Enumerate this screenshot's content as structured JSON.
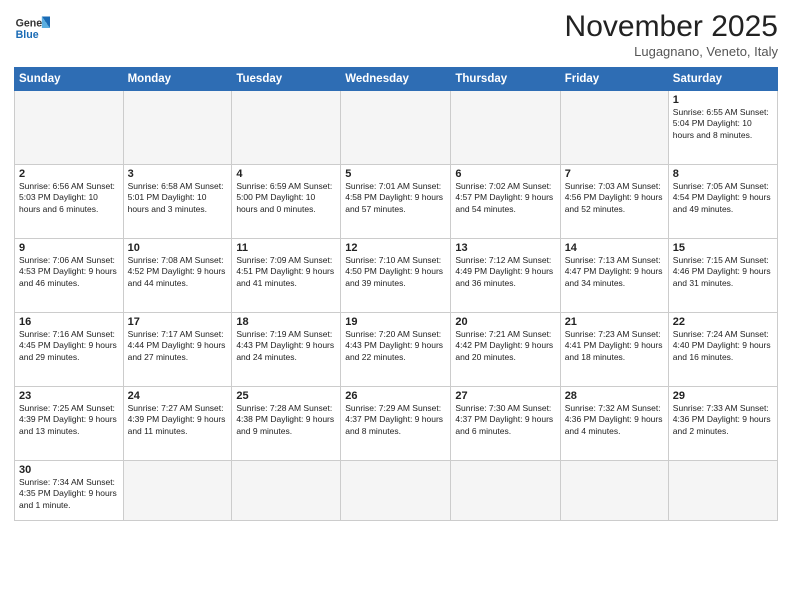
{
  "header": {
    "logo_general": "General",
    "logo_blue": "Blue",
    "month_title": "November 2025",
    "location": "Lugagnano, Veneto, Italy"
  },
  "days_of_week": [
    "Sunday",
    "Monday",
    "Tuesday",
    "Wednesday",
    "Thursday",
    "Friday",
    "Saturday"
  ],
  "weeks": [
    [
      {
        "num": "",
        "info": "",
        "empty": true
      },
      {
        "num": "",
        "info": "",
        "empty": true
      },
      {
        "num": "",
        "info": "",
        "empty": true
      },
      {
        "num": "",
        "info": "",
        "empty": true
      },
      {
        "num": "",
        "info": "",
        "empty": true
      },
      {
        "num": "",
        "info": "",
        "empty": true
      },
      {
        "num": "1",
        "info": "Sunrise: 6:55 AM\nSunset: 5:04 PM\nDaylight: 10 hours\nand 8 minutes.",
        "empty": false
      }
    ],
    [
      {
        "num": "2",
        "info": "Sunrise: 6:56 AM\nSunset: 5:03 PM\nDaylight: 10 hours\nand 6 minutes.",
        "empty": false
      },
      {
        "num": "3",
        "info": "Sunrise: 6:58 AM\nSunset: 5:01 PM\nDaylight: 10 hours\nand 3 minutes.",
        "empty": false
      },
      {
        "num": "4",
        "info": "Sunrise: 6:59 AM\nSunset: 5:00 PM\nDaylight: 10 hours\nand 0 minutes.",
        "empty": false
      },
      {
        "num": "5",
        "info": "Sunrise: 7:01 AM\nSunset: 4:58 PM\nDaylight: 9 hours\nand 57 minutes.",
        "empty": false
      },
      {
        "num": "6",
        "info": "Sunrise: 7:02 AM\nSunset: 4:57 PM\nDaylight: 9 hours\nand 54 minutes.",
        "empty": false
      },
      {
        "num": "7",
        "info": "Sunrise: 7:03 AM\nSunset: 4:56 PM\nDaylight: 9 hours\nand 52 minutes.",
        "empty": false
      },
      {
        "num": "8",
        "info": "Sunrise: 7:05 AM\nSunset: 4:54 PM\nDaylight: 9 hours\nand 49 minutes.",
        "empty": false
      }
    ],
    [
      {
        "num": "9",
        "info": "Sunrise: 7:06 AM\nSunset: 4:53 PM\nDaylight: 9 hours\nand 46 minutes.",
        "empty": false
      },
      {
        "num": "10",
        "info": "Sunrise: 7:08 AM\nSunset: 4:52 PM\nDaylight: 9 hours\nand 44 minutes.",
        "empty": false
      },
      {
        "num": "11",
        "info": "Sunrise: 7:09 AM\nSunset: 4:51 PM\nDaylight: 9 hours\nand 41 minutes.",
        "empty": false
      },
      {
        "num": "12",
        "info": "Sunrise: 7:10 AM\nSunset: 4:50 PM\nDaylight: 9 hours\nand 39 minutes.",
        "empty": false
      },
      {
        "num": "13",
        "info": "Sunrise: 7:12 AM\nSunset: 4:49 PM\nDaylight: 9 hours\nand 36 minutes.",
        "empty": false
      },
      {
        "num": "14",
        "info": "Sunrise: 7:13 AM\nSunset: 4:47 PM\nDaylight: 9 hours\nand 34 minutes.",
        "empty": false
      },
      {
        "num": "15",
        "info": "Sunrise: 7:15 AM\nSunset: 4:46 PM\nDaylight: 9 hours\nand 31 minutes.",
        "empty": false
      }
    ],
    [
      {
        "num": "16",
        "info": "Sunrise: 7:16 AM\nSunset: 4:45 PM\nDaylight: 9 hours\nand 29 minutes.",
        "empty": false
      },
      {
        "num": "17",
        "info": "Sunrise: 7:17 AM\nSunset: 4:44 PM\nDaylight: 9 hours\nand 27 minutes.",
        "empty": false
      },
      {
        "num": "18",
        "info": "Sunrise: 7:19 AM\nSunset: 4:43 PM\nDaylight: 9 hours\nand 24 minutes.",
        "empty": false
      },
      {
        "num": "19",
        "info": "Sunrise: 7:20 AM\nSunset: 4:43 PM\nDaylight: 9 hours\nand 22 minutes.",
        "empty": false
      },
      {
        "num": "20",
        "info": "Sunrise: 7:21 AM\nSunset: 4:42 PM\nDaylight: 9 hours\nand 20 minutes.",
        "empty": false
      },
      {
        "num": "21",
        "info": "Sunrise: 7:23 AM\nSunset: 4:41 PM\nDaylight: 9 hours\nand 18 minutes.",
        "empty": false
      },
      {
        "num": "22",
        "info": "Sunrise: 7:24 AM\nSunset: 4:40 PM\nDaylight: 9 hours\nand 16 minutes.",
        "empty": false
      }
    ],
    [
      {
        "num": "23",
        "info": "Sunrise: 7:25 AM\nSunset: 4:39 PM\nDaylight: 9 hours\nand 13 minutes.",
        "empty": false
      },
      {
        "num": "24",
        "info": "Sunrise: 7:27 AM\nSunset: 4:39 PM\nDaylight: 9 hours\nand 11 minutes.",
        "empty": false
      },
      {
        "num": "25",
        "info": "Sunrise: 7:28 AM\nSunset: 4:38 PM\nDaylight: 9 hours\nand 9 minutes.",
        "empty": false
      },
      {
        "num": "26",
        "info": "Sunrise: 7:29 AM\nSunset: 4:37 PM\nDaylight: 9 hours\nand 8 minutes.",
        "empty": false
      },
      {
        "num": "27",
        "info": "Sunrise: 7:30 AM\nSunset: 4:37 PM\nDaylight: 9 hours\nand 6 minutes.",
        "empty": false
      },
      {
        "num": "28",
        "info": "Sunrise: 7:32 AM\nSunset: 4:36 PM\nDaylight: 9 hours\nand 4 minutes.",
        "empty": false
      },
      {
        "num": "29",
        "info": "Sunrise: 7:33 AM\nSunset: 4:36 PM\nDaylight: 9 hours\nand 2 minutes.",
        "empty": false
      }
    ],
    [
      {
        "num": "30",
        "info": "Sunrise: 7:34 AM\nSunset: 4:35 PM\nDaylight: 9 hours\nand 1 minute.",
        "empty": false
      },
      {
        "num": "",
        "info": "",
        "empty": true
      },
      {
        "num": "",
        "info": "",
        "empty": true
      },
      {
        "num": "",
        "info": "",
        "empty": true
      },
      {
        "num": "",
        "info": "",
        "empty": true
      },
      {
        "num": "",
        "info": "",
        "empty": true
      },
      {
        "num": "",
        "info": "",
        "empty": true
      }
    ]
  ]
}
